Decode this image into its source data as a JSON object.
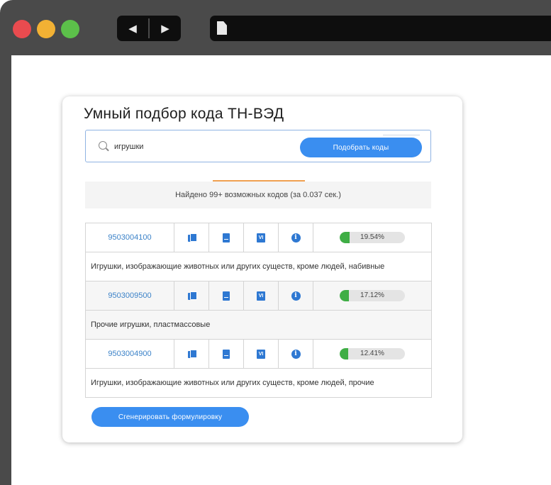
{
  "browser": {
    "back_icon": "◀",
    "forward_icon": "▶"
  },
  "app": {
    "title": "Умный подбор кода ТН-ВЭД"
  },
  "search": {
    "value": "игрушки",
    "button_label": "Подобрать коды"
  },
  "results": {
    "summary": "Найдено 99+ возможных кодов (за 0.037 сек.)"
  },
  "rows": [
    {
      "code": "9503004100",
      "relevance": "19.54%",
      "relevance_fraction": 0.1954,
      "description": "Игрушки, изображающие животных или других существ, кроме людей, набивные"
    },
    {
      "code": "9503009500",
      "relevance": "17.12%",
      "relevance_fraction": 0.1712,
      "description": "Прочие игрушки, пластмассовые"
    },
    {
      "code": "9503004900",
      "relevance": "12.41%",
      "relevance_fraction": 0.1241,
      "description": "Игрушки, изображающие животных или других существ, кроме людей, прочие"
    }
  ],
  "icons": {
    "vi_label": "VI",
    "info_label": "i"
  },
  "footer": {
    "generate_label": "Сгенерировать формулировку"
  },
  "colors": {
    "accent": "#3a8ef0",
    "relevance_green": "#3fae45",
    "code_link": "#3b82c8"
  }
}
